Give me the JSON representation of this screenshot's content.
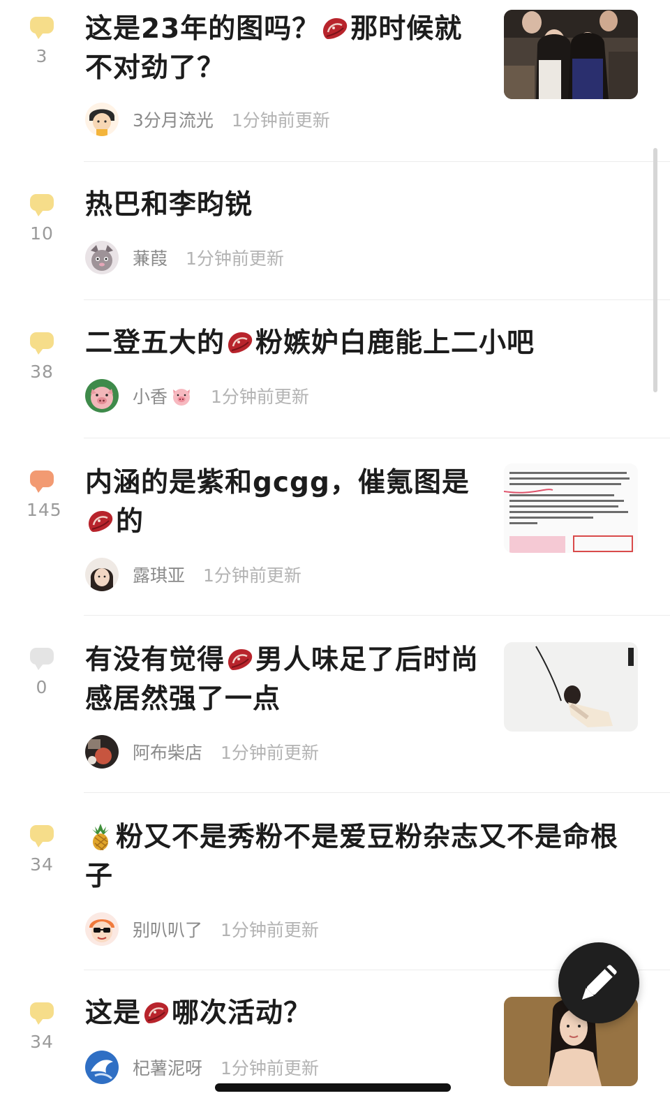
{
  "colors": {
    "bubble_yellow": "#f6dd8a",
    "bubble_orange": "#f29a72",
    "bubble_grey": "#e4e4e4",
    "title_text": "#1c1c1c",
    "meta_text": "#8a8a8a",
    "time_text": "#b3b3b3",
    "fab_bg": "#1f1f1f"
  },
  "feed": {
    "items": [
      {
        "replies": "3",
        "bubble": "yellow",
        "title_parts": [
          "这是23年的图吗？",
          "[meat-emoji]",
          "那时候就不对劲了？"
        ],
        "author": "3分月流光",
        "time": "1分钟前更新",
        "avatar_icon": "cartoon-girl-avatar",
        "thumb": "event-photo-thumbnail"
      },
      {
        "replies": "10",
        "bubble": "yellow",
        "title_parts": [
          "热巴和李昀锐"
        ],
        "author": "蒹葭",
        "time": "1分钟前更新",
        "avatar_icon": "cat-avatar",
        "thumb": null
      },
      {
        "replies": "38",
        "bubble": "yellow",
        "title_parts": [
          "二登五大的",
          "[meat-emoji]",
          "粉嫉妒白鹿能上二小吧"
        ],
        "author": "小香",
        "author_emoji": "pig-emoji",
        "time": "1分钟前更新",
        "avatar_icon": "pig-avatar",
        "thumb": null
      },
      {
        "replies": "145",
        "bubble": "orange",
        "title_parts": [
          "内涵的是紫和gcgg，催氪图是",
          "[meat-emoji]",
          "的"
        ],
        "author": "露琪亚",
        "time": "1分钟前更新",
        "avatar_icon": "girl-photo-avatar",
        "thumb": "text-screenshot-thumbnail"
      },
      {
        "replies": "0",
        "bubble": "grey",
        "title_parts": [
          "有没有觉得",
          "[meat-emoji]",
          "男人味足了后时尚感居然强了一点"
        ],
        "author": "阿布柴店",
        "time": "1分钟前更新",
        "avatar_icon": "dark-photo-avatar",
        "thumb": "fashion-photo-thumbnail"
      },
      {
        "replies": "34",
        "bubble": "yellow",
        "title_parts": [
          "[pineapple-emoji]",
          "粉又不是秀粉不是爱豆粉杂志又不是命根子"
        ],
        "author": "别叭叭了",
        "time": "1分钟前更新",
        "avatar_icon": "sunglasses-cartoon-avatar",
        "thumb": null
      },
      {
        "replies": "34",
        "bubble": "yellow",
        "title_parts": [
          "这是",
          "[meat-emoji]",
          "哪次活动？"
        ],
        "author": "杞薯泥呀",
        "time": "1分钟前更新",
        "avatar_icon": "blue-bird-avatar",
        "thumb": "portrait-photo-thumbnail"
      }
    ]
  },
  "fab": {
    "icon": "pen-icon"
  }
}
